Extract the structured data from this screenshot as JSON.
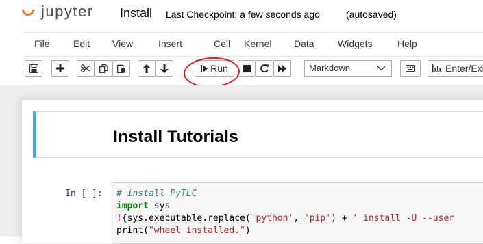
{
  "header": {
    "logo_text": "jupyter",
    "notebook_title": "Install",
    "checkpoint": "Last Checkpoint: a few seconds ago",
    "autosave_status": "(autosaved)"
  },
  "menubar": {
    "items": [
      "File",
      "Edit",
      "View",
      "Insert",
      "Cell",
      "Kernel",
      "Data",
      "Widgets",
      "Help"
    ]
  },
  "toolbar": {
    "run_label": "Run",
    "cell_type": "Markdown",
    "enter_exit_label": "Enter/Exi"
  },
  "notebook": {
    "markdown_heading": "Install Tutorials",
    "code_prompt": "In [ ]:",
    "code": {
      "line1": "# install PyTLC",
      "line2_kw": "import",
      "line2_rest": " sys",
      "line3_op": "!",
      "line3_a": "{sys.executable.replace(",
      "line3_s1": "'python'",
      "line3_b": ", ",
      "line3_s2": "'pip'",
      "line3_c": ") + ",
      "line3_s3": "' install -U --user",
      "line4_a": "print(",
      "line4_s": "\"wheel installed.\"",
      "line4_b": ")"
    }
  },
  "colors": {
    "logo_orange": "#f37726",
    "annotation_red": "#e0201b",
    "cell_selected_blue": "#42a5f5",
    "prompt_blue": "#303f9f"
  }
}
